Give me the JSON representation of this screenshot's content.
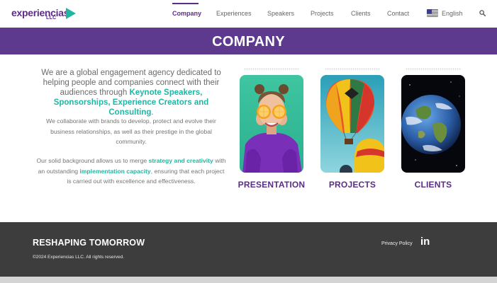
{
  "brand": {
    "logo_main": "experiencias",
    "logo_sub": "LLC",
    "colors": {
      "purple": "#5e3a8e",
      "teal": "#1fb7a3",
      "footer": "#3d3d3d"
    }
  },
  "nav": {
    "items": [
      {
        "label": "Company",
        "active": true
      },
      {
        "label": "Experiences",
        "active": false
      },
      {
        "label": "Speakers",
        "active": false
      },
      {
        "label": "Projects",
        "active": false
      },
      {
        "label": "Clients",
        "active": false
      },
      {
        "label": "Contact",
        "active": false
      }
    ],
    "language": "English",
    "language_icon": "us-flag-icon",
    "search_icon": "search-icon"
  },
  "banner": {
    "title": "COMPANY"
  },
  "intro": {
    "text_before": "We are a global engagement agency dedicated to helping people and companies connect with their audiences through ",
    "highlight": "Keynote Speakers, Sponsorships, Experience Creators and Consulting",
    "text_after": "."
  },
  "para1": "We collaborate with brands to develop, protect and evolve their business relationships, as well as their prestige in the global community.",
  "para2": {
    "t1": "Our solid background allows us to merge ",
    "h1": "strategy and creativity",
    "t2": " with an outstanding ",
    "h2": "implementation capacity",
    "t3": ", ensuring that each project is carried out with excellence and effectiveness."
  },
  "cards": [
    {
      "label": "PRESENTATION",
      "image": "woman-with-orange-slices-image"
    },
    {
      "label": "PROJECTS",
      "image": "hot-air-balloons-image"
    },
    {
      "label": "CLIENTS",
      "image": "earth-globe-image"
    }
  ],
  "footer": {
    "title": "RESHAPING TOMORROW",
    "copyright": "©2024 Experiencias LLC. All rights reserved.",
    "privacy": "Privacy Policy",
    "social_icon": "linkedin-icon",
    "social_text": "in"
  }
}
